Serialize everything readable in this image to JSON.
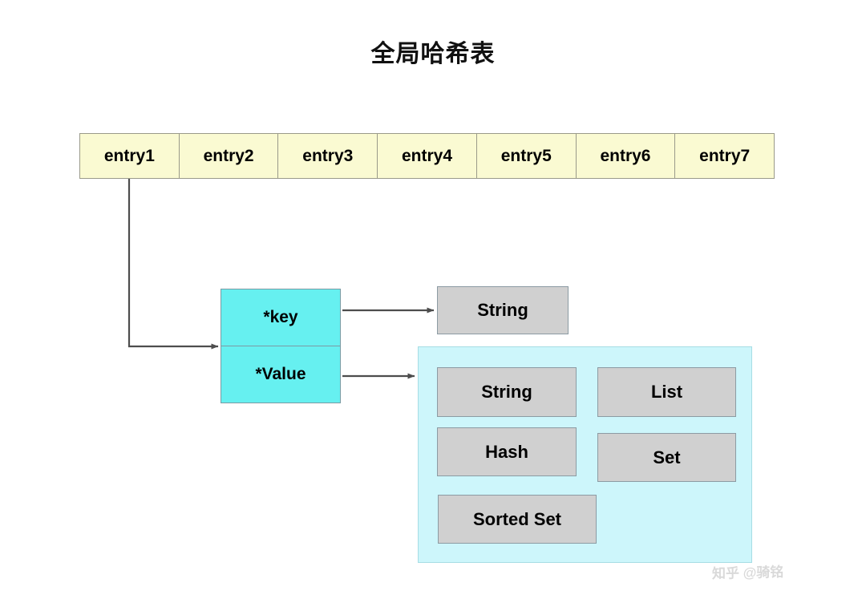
{
  "diagram": {
    "title": "全局哈希表",
    "hash_table": {
      "name": "global-hash-table",
      "entries": [
        {
          "label": "entry1"
        },
        {
          "label": "entry2"
        },
        {
          "label": "entry3"
        },
        {
          "label": "entry4"
        },
        {
          "label": "entry5"
        },
        {
          "label": "entry6"
        },
        {
          "label": "entry7"
        }
      ]
    },
    "entry_node": {
      "key_label": "*key",
      "value_label": "*Value"
    },
    "key_type": {
      "label": "String"
    },
    "value_types": {
      "items": [
        {
          "label": "String"
        },
        {
          "label": "List"
        },
        {
          "label": "Hash"
        },
        {
          "label": "Set"
        },
        {
          "label": "Sorted Set"
        }
      ]
    },
    "watermark": "知乎 @骑铭",
    "colors": {
      "entry_fill": "#fafad2",
      "entry_border": "#9a9a8a",
      "kv_fill": "#66f0f0",
      "kv_border": "#7b9aa3",
      "type_fill": "#d0d0d0",
      "type_border": "#8c9ba3",
      "container_fill": "#cdf6fb",
      "container_border": "#a7dde4",
      "arrow": "#4d4d4d",
      "background": "#ffffff"
    }
  }
}
